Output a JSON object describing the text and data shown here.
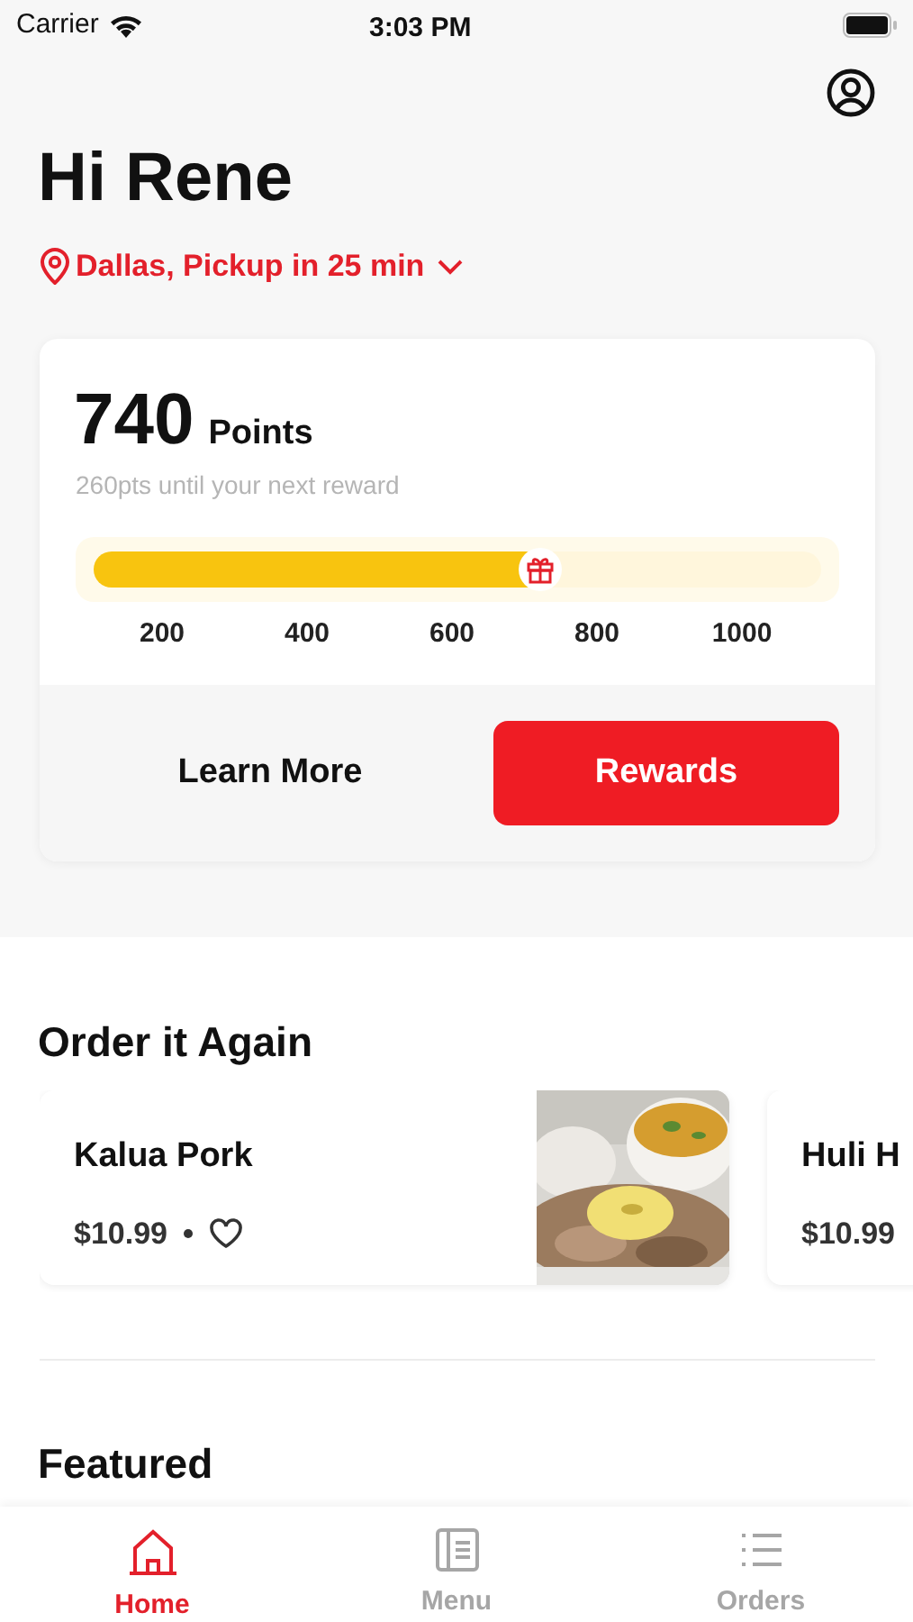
{
  "status_bar": {
    "carrier": "Carrier",
    "time": "3:03 PM"
  },
  "greeting": "Hi Rene",
  "location": "Dallas, Pickup in 25 min",
  "rewards": {
    "points": "740",
    "points_label": "Points",
    "subtitle": "260pts until your next reward",
    "level": 0.62,
    "ticks": [
      "200",
      "400",
      "600",
      "800",
      "1000"
    ],
    "buttons": [
      {
        "label": "Learn More",
        "kind": "plain"
      },
      {
        "label": "Rewards",
        "kind": "primary"
      }
    ]
  },
  "order_again": {
    "title": "Order it Again",
    "items": [
      {
        "name": "Kalua Pork",
        "price": "$10.99",
        "favorite": false,
        "kind": "picture"
      },
      {
        "name": "Huli H",
        "price": "$10.99"
      }
    ]
  },
  "featured": {
    "title": "Featured"
  },
  "tabs": [
    {
      "label": "Home",
      "selected": true
    },
    {
      "label": "Menu",
      "selected": false
    },
    {
      "label": "Orders",
      "selected": false
    }
  ]
}
